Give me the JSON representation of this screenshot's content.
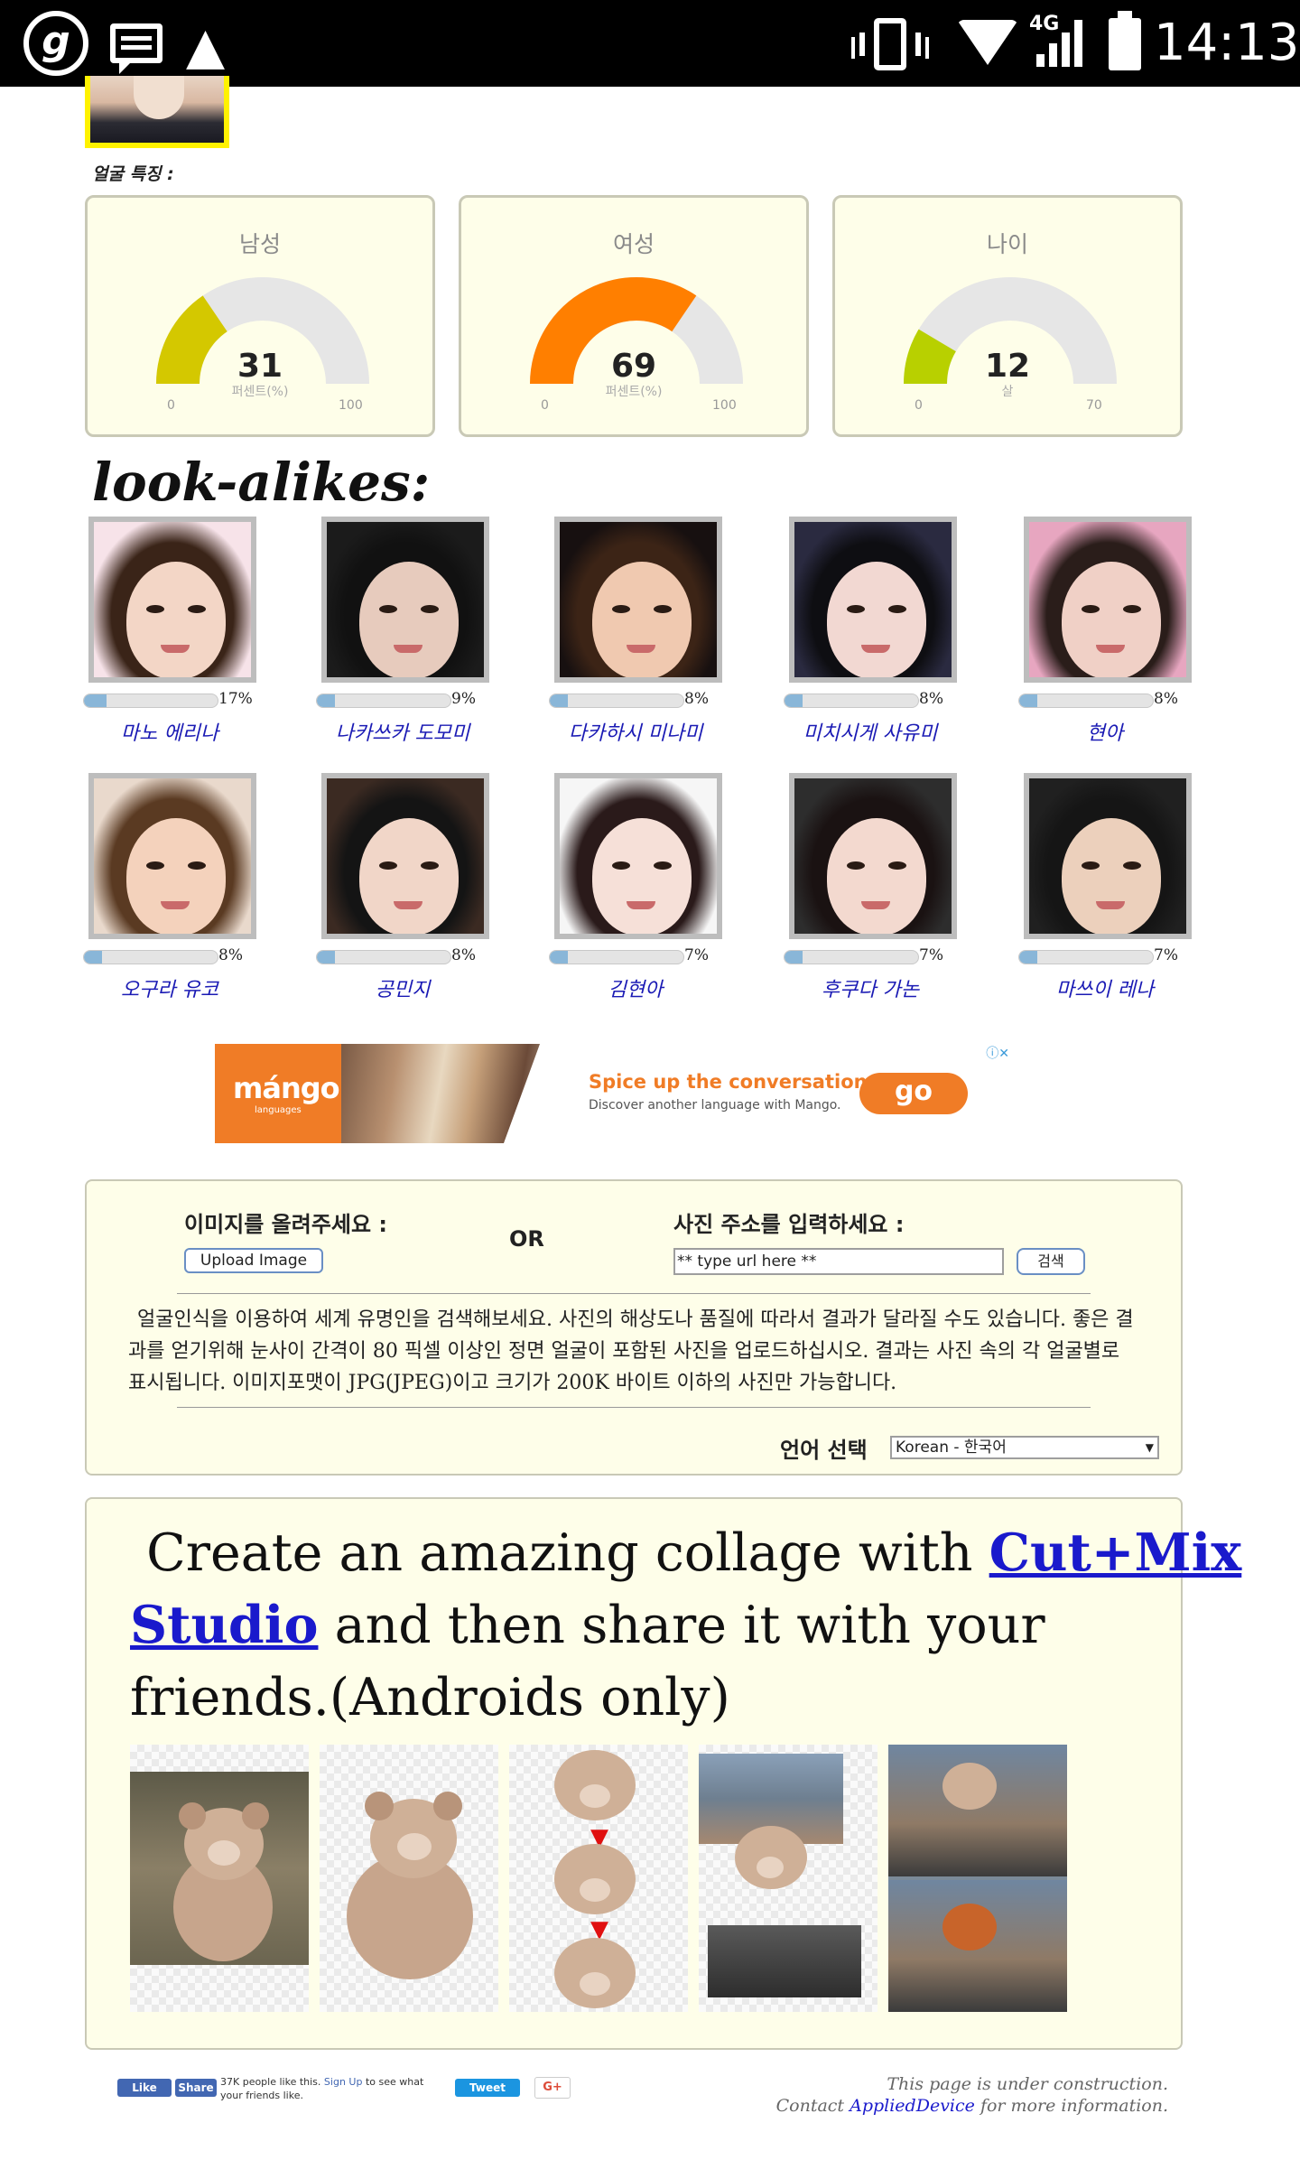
{
  "status_bar": {
    "time": "14:13",
    "network": "4G",
    "icons": [
      "app-g-icon",
      "message-icon",
      "dog-icon",
      "vibrate-icon",
      "wifi-icon",
      "signal-icon",
      "battery-icon"
    ]
  },
  "face_features_label": "얼굴 특징 :",
  "gauges": [
    {
      "title": "남성",
      "value": "31",
      "unit": "퍼센트(%)",
      "min": "0",
      "max": "100",
      "fraction": 0.31,
      "color": "#d4c800"
    },
    {
      "title": "여성",
      "value": "69",
      "unit": "퍼센트(%)",
      "min": "0",
      "max": "100",
      "fraction": 0.69,
      "color": "#ff7f00"
    },
    {
      "title": "나이",
      "value": "12",
      "unit": "살",
      "min": "0",
      "max": "70",
      "fraction": 0.171,
      "color": "#b8d000"
    }
  ],
  "lookalikes_title": "look-alikes:",
  "lookalikes": [
    {
      "name": "마노 에리나",
      "percent": "17%",
      "fraction": 0.17
    },
    {
      "name": "나카쓰카 도모미",
      "percent": "9%",
      "fraction": 0.09
    },
    {
      "name": "다카하시 미나미",
      "percent": "8%",
      "fraction": 0.08
    },
    {
      "name": "미치시게 사유미",
      "percent": "8%",
      "fraction": 0.08
    },
    {
      "name": "현아",
      "percent": "8%",
      "fraction": 0.08
    },
    {
      "name": "오구라 유코",
      "percent": "8%",
      "fraction": 0.08
    },
    {
      "name": "공민지",
      "percent": "8%",
      "fraction": 0.08
    },
    {
      "name": "김현아",
      "percent": "7%",
      "fraction": 0.07
    },
    {
      "name": "후쿠다 가논",
      "percent": "7%",
      "fraction": 0.07
    },
    {
      "name": "마쓰이 레나",
      "percent": "7%",
      "fraction": 0.07
    }
  ],
  "ad": {
    "brand": "mángo",
    "brand_sub": "languages",
    "headline": "Spice up the conversation.",
    "sub": "Discover another language with Mango.",
    "cta": "go",
    "choice": "ⓘ✕"
  },
  "upload": {
    "upload_label": "이미지를 올려주세요 :",
    "upload_button": "Upload Image",
    "or_label": "OR",
    "url_label": "사진 주소를 입력하세요 :",
    "url_value": "** type url here **",
    "search_button": "검색",
    "description": "얼굴인식을 이용하여 세계 유명인을 검색해보세요. 사진의 해상도나 품질에 따라서 결과가 달라질 수도 있습니다. 좋은 결과를 얻기위해 눈사이 간격이 80 픽셀 이상인 정면 얼굴이 포함된 사진을 업로드하십시오. 결과는 사진 속의 각 얼굴별로 표시됩니다. 이미지포맷이 JPG(JPEG)이고 크기가 200K 바이트 이하의 사진만 가능합니다.",
    "language_label": "언어 선택",
    "language_value": "Korean - 한국어"
  },
  "collage": {
    "text_before": " Create an amazing collage with ",
    "link": "Cut+Mix Studio",
    "text_after": " and then share it with your friends.(Androids only)"
  },
  "footer": {
    "like_button": "Like",
    "share_button": "Share",
    "fb_count_text": "37K people like this.",
    "fb_signup": "Sign Up",
    "fb_rest": "to see what your friends like.",
    "tweet_button": "Tweet",
    "gplus_button": "G+",
    "note_line1": "This page is under construction.",
    "note_contact": "Contact",
    "note_link": "AppliedDevice",
    "note_rest": "for more information."
  }
}
